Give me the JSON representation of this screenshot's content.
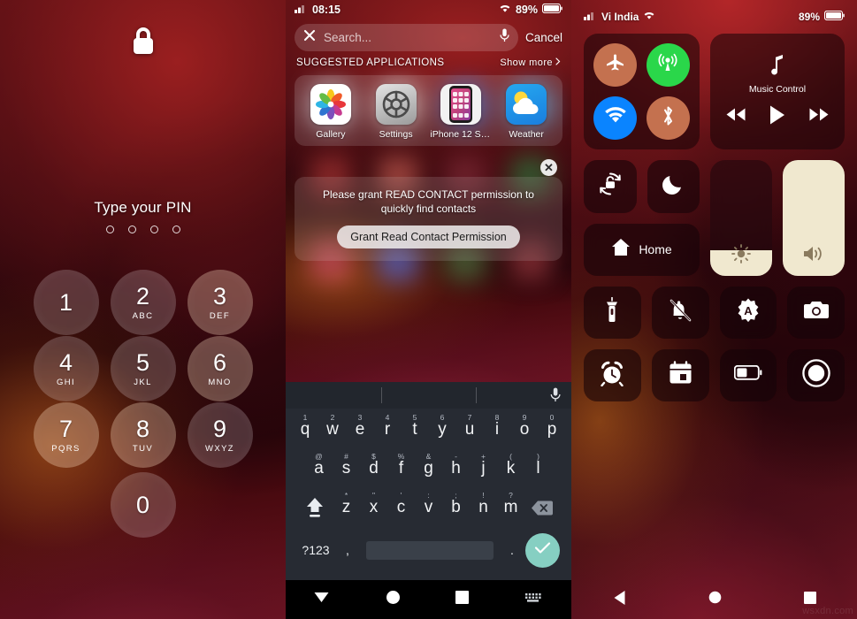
{
  "lockscreen": {
    "lock_icon": "lock-closed-icon",
    "prompt": "Type your PIN",
    "pin_dot_count": 4,
    "keys": [
      {
        "num": "1",
        "letters": ""
      },
      {
        "num": "2",
        "letters": "ABC"
      },
      {
        "num": "3",
        "letters": "DEF"
      },
      {
        "num": "4",
        "letters": "GHI"
      },
      {
        "num": "5",
        "letters": "JKL"
      },
      {
        "num": "6",
        "letters": "MNO"
      },
      {
        "num": "7",
        "letters": "PQRS"
      },
      {
        "num": "8",
        "letters": "TUV"
      },
      {
        "num": "9",
        "letters": "WXYZ"
      },
      {
        "num": "0",
        "letters": ""
      }
    ]
  },
  "search_panel": {
    "statusbar": {
      "signal_icon": "cellular-signal-icon",
      "time": "08:15",
      "wifi_icon": "wifi-icon",
      "battery_percent": "89%",
      "battery_icon": "battery-icon"
    },
    "search": {
      "clear_icon": "close-x-icon",
      "placeholder": "Search...",
      "mic_icon": "microphone-icon",
      "cancel_label": "Cancel"
    },
    "suggested": {
      "header": "SUGGESTED APPLICATIONS",
      "show_more": "Show more",
      "chevron_icon": "chevron-right-icon",
      "apps": [
        {
          "label": "Gallery",
          "icon": "photos-app-icon"
        },
        {
          "label": "Settings",
          "icon": "settings-gear-icon"
        },
        {
          "label": "iPhone 12 Setti...",
          "icon": "iphone-settings-app-icon"
        },
        {
          "label": "Weather",
          "icon": "weather-cloud-sun-icon"
        }
      ]
    },
    "permission": {
      "close_icon": "close-circle-icon",
      "message": "Please grant READ CONTACT permission to quickly find contacts",
      "button_label": "Grant Read Contact Permission"
    },
    "assistive_touch": "assistive-touch-button",
    "keyboard": {
      "mic_icon": "microphone-icon",
      "row1": [
        {
          "key": "q",
          "alt": "1"
        },
        {
          "key": "w",
          "alt": "2"
        },
        {
          "key": "e",
          "alt": "3"
        },
        {
          "key": "r",
          "alt": "4"
        },
        {
          "key": "t",
          "alt": "5"
        },
        {
          "key": "y",
          "alt": "6"
        },
        {
          "key": "u",
          "alt": "7"
        },
        {
          "key": "i",
          "alt": "8"
        },
        {
          "key": "o",
          "alt": "9"
        },
        {
          "key": "p",
          "alt": "0"
        }
      ],
      "row2": [
        {
          "key": "a",
          "alt": "@"
        },
        {
          "key": "s",
          "alt": "#"
        },
        {
          "key": "d",
          "alt": "$"
        },
        {
          "key": "f",
          "alt": "%"
        },
        {
          "key": "g",
          "alt": "&"
        },
        {
          "key": "h",
          "alt": "-"
        },
        {
          "key": "j",
          "alt": "+"
        },
        {
          "key": "k",
          "alt": "("
        },
        {
          "key": "l",
          "alt": ")"
        }
      ],
      "row3": [
        {
          "key": "z",
          "alt": "*"
        },
        {
          "key": "x",
          "alt": "\""
        },
        {
          "key": "c",
          "alt": "'"
        },
        {
          "key": "v",
          "alt": ":"
        },
        {
          "key": "b",
          "alt": ";"
        },
        {
          "key": "n",
          "alt": "!"
        },
        {
          "key": "m",
          "alt": "?"
        }
      ],
      "shift_icon": "shift-arrow-icon",
      "delete_icon": "backspace-icon",
      "symbols_label": "?123",
      "comma": ",",
      "period": ".",
      "enter_icon": "checkmark-icon"
    },
    "navbar": {
      "back_icon": "nav-back-triangle-icon",
      "home_icon": "nav-home-circle-icon",
      "recents_icon": "nav-recents-square-icon",
      "keyboard_icon": "nav-keyboard-icon"
    }
  },
  "control_center": {
    "statusbar": {
      "signal_icon": "cellular-signal-icon",
      "carrier": "Vi India",
      "wifi_icon": "wifi-icon",
      "battery_percent": "89%",
      "battery_icon": "battery-icon"
    },
    "connectivity": [
      {
        "name": "airplane-mode-toggle",
        "icon": "airplane-icon",
        "state": "off",
        "color": "#c4714f"
      },
      {
        "name": "cellular-data-toggle",
        "icon": "cellular-tower-icon",
        "state": "on",
        "color": "#2ad74a"
      },
      {
        "name": "wifi-toggle",
        "icon": "wifi-icon",
        "state": "on",
        "color": "#0a84ff"
      },
      {
        "name": "bluetooth-toggle",
        "icon": "bluetooth-icon",
        "state": "off",
        "color": "#c4714f"
      }
    ],
    "music": {
      "note_icon": "music-note-icon",
      "label": "Music Control",
      "prev_icon": "rewind-icon",
      "play_icon": "play-icon",
      "next_icon": "fast-forward-icon"
    },
    "tiles_mid": [
      {
        "name": "rotation-lock-tile",
        "icon": "rotation-lock-icon"
      },
      {
        "name": "do-not-disturb-tile",
        "icon": "moon-icon"
      }
    ],
    "home_tile": {
      "icon": "home-icon",
      "label": "Home"
    },
    "brightness": {
      "name": "brightness-slider",
      "icon": "brightness-sun-icon",
      "value_percent": 22
    },
    "volume": {
      "name": "volume-slider",
      "icon": "speaker-volume-icon",
      "value_percent": 100
    },
    "tiles_bottom": [
      {
        "name": "flashlight-tile",
        "icon": "flashlight-icon"
      },
      {
        "name": "mute-tile",
        "icon": "bell-off-icon"
      },
      {
        "name": "auto-brightness-tile",
        "icon": "auto-brightness-a-icon"
      },
      {
        "name": "camera-tile",
        "icon": "camera-icon"
      },
      {
        "name": "alarm-tile",
        "icon": "alarm-clock-icon"
      },
      {
        "name": "calendar-tile",
        "icon": "calendar-icon"
      },
      {
        "name": "low-power-tile",
        "icon": "battery-half-icon"
      },
      {
        "name": "screen-record-tile",
        "icon": "record-circle-icon"
      }
    ],
    "navbar": {
      "back_icon": "nav-back-triangle-icon",
      "home_icon": "nav-home-circle-icon",
      "recents_icon": "nav-recents-square-icon"
    },
    "watermark": "wsxdn.com"
  }
}
